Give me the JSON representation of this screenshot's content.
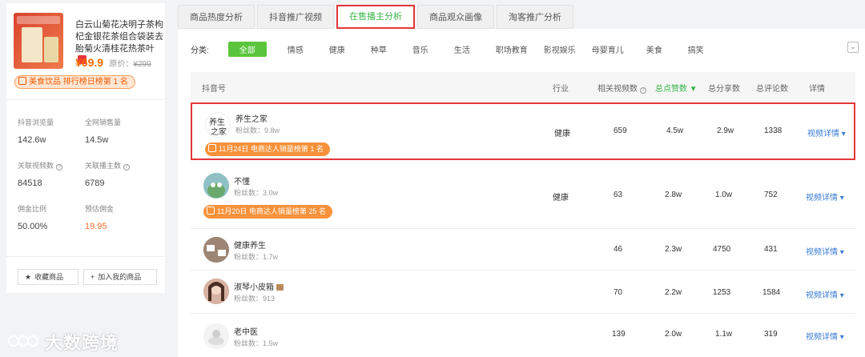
{
  "product": {
    "title": "白云山菊花决明子茶枸杞金银花茶组合袋装去胎菊火清桂花热茶叶",
    "price": "¥69.9",
    "orig_label": "原价：",
    "orig_price": "¥299",
    "rank_badge": "美食饮品 排行榜日榜第 1 名",
    "stats": [
      {
        "label": "抖音浏览量",
        "value": "142.6w"
      },
      {
        "label": "全网销售量",
        "value": "14.5w"
      },
      {
        "label": "关联视频数",
        "value": "84518"
      },
      {
        "label": "关联播主数",
        "value": "6789"
      },
      {
        "label": "佣金比例",
        "value": "50.00%"
      },
      {
        "label": "预估佣金",
        "value": "19.95"
      }
    ],
    "fav_button": "收藏商品",
    "add_button": "加入我的商品"
  },
  "watermark": "大数跨境",
  "tabs": [
    "商品热度分析",
    "抖音推广视频",
    "在售播主分析",
    "商品观众画像",
    "淘客推广分析"
  ],
  "filter": {
    "label": "分类:",
    "options": [
      "全部",
      "情感",
      "健康",
      "种草",
      "音乐",
      "生活",
      "职场教育",
      "影视娱乐",
      "母婴育儿",
      "美食",
      "搞笑"
    ]
  },
  "table": {
    "headers": [
      "抖音号",
      "行业",
      "相关视频数",
      "总点赞数",
      "总分享数",
      "总评论数",
      "详情"
    ],
    "detail_label": "视频详情",
    "rows": [
      {
        "name": "养生之家",
        "fans": "粉丝数：9.8w",
        "badge": "11月24日 电商达人销量榜第 1 名",
        "industry": "健康",
        "videos": "659",
        "likes": "4.5w",
        "shares": "2.9w",
        "comments": "1338"
      },
      {
        "name": "不懂",
        "fans": "粉丝数：3.0w",
        "badge": "11月20日 电商达人销量榜第 25 名",
        "industry": "健康",
        "videos": "63",
        "likes": "2.8w",
        "shares": "1.0w",
        "comments": "752"
      },
      {
        "name": "健康养生",
        "fans": "粉丝数：1.7w",
        "industry": "",
        "videos": "46",
        "likes": "2.3w",
        "shares": "4750",
        "comments": "431"
      },
      {
        "name": "淑琴小皮箱",
        "fans": "粉丝数：913",
        "industry": "",
        "videos": "70",
        "likes": "2.2w",
        "shares": "1253",
        "comments": "1584"
      },
      {
        "name": "老中医",
        "fans": "粉丝数：1.5w",
        "industry": "",
        "videos": "139",
        "likes": "2.0w",
        "shares": "1.1w",
        "comments": "319"
      }
    ]
  },
  "colors": {
    "accent_green": "#39b54a",
    "highlight_red": "#e4363b",
    "link_blue": "#3a7bd5",
    "badge_orange": "#f7923a"
  }
}
